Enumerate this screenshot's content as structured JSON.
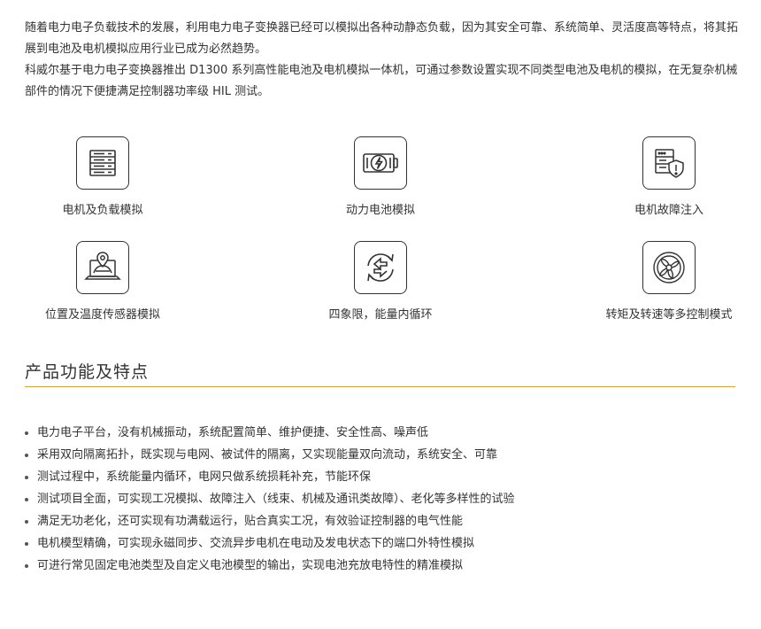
{
  "intro": {
    "paragraphs": [
      "随着电力电子负载技术的发展，利用电力电子变换器已经可以模拟出各种动静态负载，因为其安全可靠、系统简单、灵活度高等特点，将其拓展到电池及电机模拟应用行业已成为必然趋势。",
      "科威尔基于电力电子变换器推出 D1300 系列高性能电池及电机模拟一体机，可通过参数设置实现不同类型电池及电机的模拟，在无复杂机械部件的情况下便捷满足控制器功率级 HIL 测试。"
    ]
  },
  "features": [
    {
      "label": "电机及负载模拟",
      "icon": "server-rack-icon"
    },
    {
      "label": "动力电池模拟",
      "icon": "battery-bolt-icon"
    },
    {
      "label": "电机故障注入",
      "icon": "server-shield-icon"
    },
    {
      "label": "位置及温度传感器模拟",
      "icon": "laptop-location-icon"
    },
    {
      "label": "四象限，能量内循环",
      "icon": "cycle-arrows-icon"
    },
    {
      "label": "转矩及转速等多控制模式",
      "icon": "fan-rotor-icon"
    }
  ],
  "section": {
    "title": "产品功能及特点",
    "accent_color": "#d9a13b"
  },
  "bullets": [
    "电力电子平台，没有机械振动，系统配置简单、维护便捷、安全性高、噪声低",
    "采用双向隔离拓扑，既实现与电网、被试件的隔离，又实现能量双向流动，系统安全、可靠",
    "测试过程中，系统能量内循环，电网只做系统损耗补充，节能环保",
    "测试项目全面，可实现工况模拟、故障注入（线束、机械及通讯类故障）、老化等多样性的试验",
    "满足无功老化，还可实现有功满载运行，贴合真实工况，有效验证控制器的电气性能",
    "电机模型精确，可实现永磁同步、交流异步电机在电动及发电状态下的端口外特性模拟",
    "可进行常见固定电池类型及自定义电池模型的输出，实现电池充放电特性的精准模拟"
  ]
}
